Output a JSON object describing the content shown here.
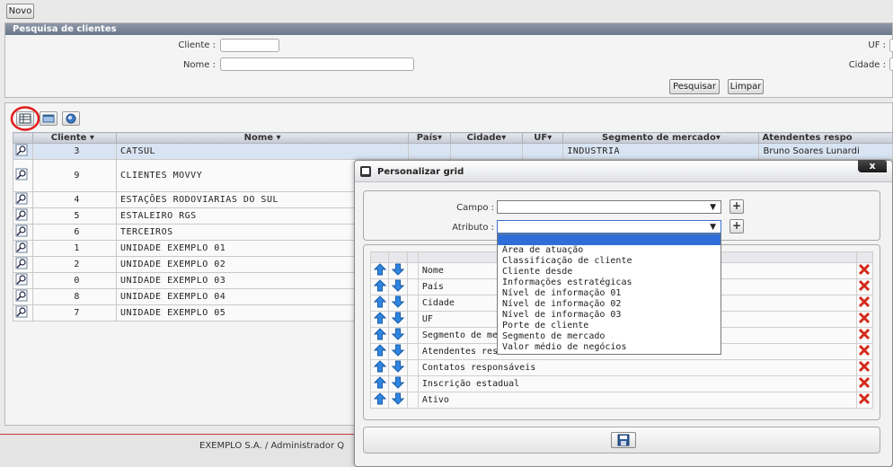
{
  "toolbar": {
    "new_label": "Novo"
  },
  "search_panel": {
    "title": "Pesquisa de clientes",
    "cliente_label": "Cliente :",
    "nome_label": "Nome :",
    "uf_label": "UF :",
    "cidade_label": "Cidade :",
    "cliente_value": "",
    "nome_value": "",
    "search_button": "Pesquisar",
    "clear_button": "Limpar"
  },
  "grid": {
    "columns": [
      "Cliente",
      "Nome",
      "País",
      "Cidade",
      "UF",
      "Segmento de mercado",
      "Atendentes respo"
    ],
    "rows": [
      {
        "cliente": "3",
        "nome": "CATSUL",
        "pais": "",
        "cidade": "",
        "uf": "",
        "segmento": "INDUSTRIA",
        "atendentes": "Bruno Soares Lunardi"
      },
      {
        "cliente": "9",
        "nome": "CLIENTES MOVVY",
        "pais": "",
        "cidade": "",
        "uf": "",
        "segmento": "",
        "atendentes": ""
      },
      {
        "cliente": "4",
        "nome": "ESTAÇÕES RODOVIARIAS DO SUL",
        "pais": "",
        "cidade": "",
        "uf": "",
        "segmento": "",
        "atendentes": ""
      },
      {
        "cliente": "5",
        "nome": "ESTALEIRO RGS",
        "pais": "",
        "cidade": "",
        "uf": "",
        "segmento": "",
        "atendentes": ""
      },
      {
        "cliente": "6",
        "nome": "TERCEIROS",
        "pais": "",
        "cidade": "",
        "uf": "",
        "segmento": "",
        "atendentes": ""
      },
      {
        "cliente": "1",
        "nome": "UNIDADE EXEMPLO 01",
        "pais": "",
        "cidade": "",
        "uf": "",
        "segmento": "",
        "atendentes": ""
      },
      {
        "cliente": "2",
        "nome": "UNIDADE EXEMPLO 02",
        "pais": "",
        "cidade": "",
        "uf": "",
        "segmento": "",
        "atendentes": ""
      },
      {
        "cliente": "0",
        "nome": "UNIDADE EXEMPLO 03",
        "pais": "",
        "cidade": "",
        "uf": "",
        "segmento": "",
        "atendentes": ""
      },
      {
        "cliente": "8",
        "nome": "UNIDADE EXEMPLO 04",
        "pais": "",
        "cidade": "",
        "uf": "",
        "segmento": "",
        "atendentes": ""
      },
      {
        "cliente": "7",
        "nome": "UNIDADE EXEMPLO 05",
        "pais": "",
        "cidade": "",
        "uf": "",
        "segmento": "",
        "atendentes": ""
      }
    ]
  },
  "footer": {
    "text": "EXEMPLO S.A. / Administrador Q"
  },
  "dialog": {
    "title": "Personalizar grid",
    "close_label": "x",
    "campo_label": "Campo :",
    "atributo_label": "Atributo :",
    "campo_value": "",
    "atributo_value": "",
    "dropdown_options": [
      "Área de atuação",
      "Classificação de cliente",
      "Cliente desde",
      "Informações estratégicas",
      "Nível de informação 01",
      "Nível de informação 02",
      "Nível de informação 03",
      "Porte de cliente",
      "Segmento de mercado",
      "Valor médio de negócios"
    ],
    "attributes": [
      "Nome",
      "País",
      "Cidade",
      "UF",
      "Segmento de me",
      "Atendentes res",
      "Contatos responsáveis",
      "Inscrição estadual",
      "Ativo"
    ]
  },
  "colors": {
    "accent_red": "#e21b1b",
    "header_bar": "#7b8699",
    "selected_blue": "#2f6ed8"
  }
}
